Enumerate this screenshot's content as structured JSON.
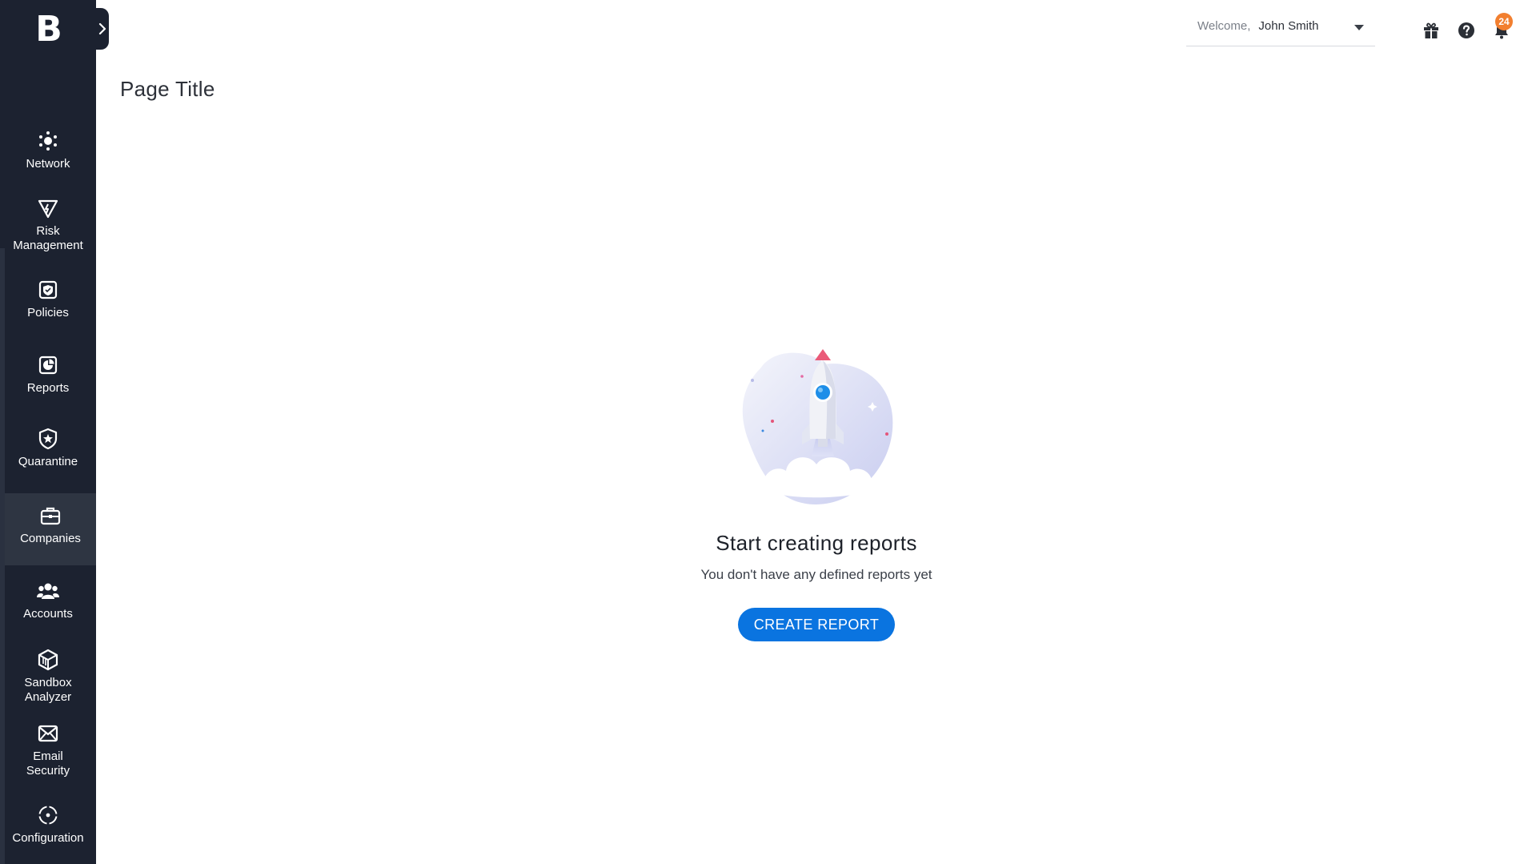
{
  "brand": {
    "logo_text": "B"
  },
  "sidebar": {
    "items": [
      {
        "label": "Network",
        "icon": "network-icon"
      },
      {
        "label": "Risk\nManagement",
        "icon": "risk-management-icon"
      },
      {
        "label": "Policies",
        "icon": "policies-icon"
      },
      {
        "label": "Reports",
        "icon": "reports-icon"
      },
      {
        "label": "Quarantine",
        "icon": "quarantine-shield-icon"
      },
      {
        "label": "Companies",
        "icon": "briefcase-icon",
        "active": true
      },
      {
        "label": "Accounts",
        "icon": "users-icon"
      },
      {
        "label": "Sandbox\nAnalyzer",
        "icon": "cube-icon"
      },
      {
        "label": "Email\nSecurity",
        "icon": "email-shield-icon"
      },
      {
        "label": "Configuration",
        "icon": "gear-icon"
      }
    ]
  },
  "header": {
    "welcome_label": "Welcome,",
    "user_name": "John Smith",
    "notification_count": "24",
    "icons": [
      "gift-icon",
      "help-icon",
      "bell-icon"
    ]
  },
  "page": {
    "title": "Page Title"
  },
  "empty_state": {
    "heading": "Start creating reports",
    "subtext": "You don't have any defined reports yet",
    "button_label": "CREATE REPORT",
    "illustration": "rocket-launch-illustration"
  },
  "colors": {
    "sidebar_bg": "#1c2230",
    "sidebar_active": "#2e3542",
    "primary": "#0a74e0",
    "badge": "#f27f2f"
  }
}
